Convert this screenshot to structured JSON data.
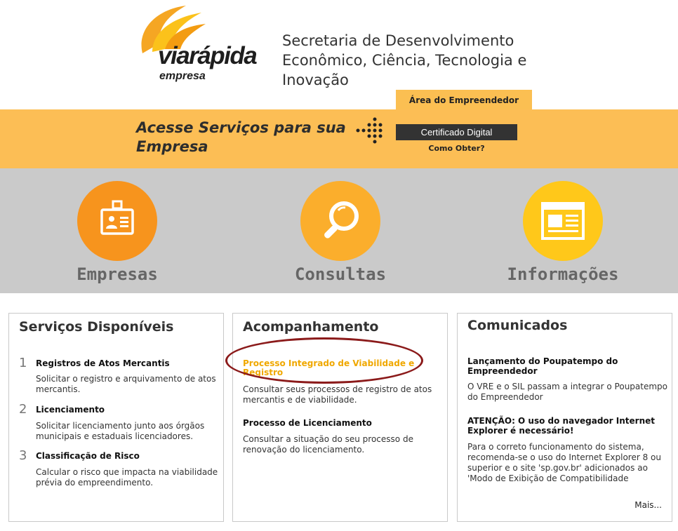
{
  "header": {
    "logo_text": "viarápida",
    "logo_sub": "empresa",
    "secretaria": "Secretaria de Desenvolvimento Econômico, Ciência, Tecnologia e Inovação",
    "area_tab": "Área do Empreendedor"
  },
  "band": {
    "title": "Acesse Serviços para sua Empresa",
    "certificado_button": "Certificado Digital",
    "como_obter": "Como Obter?"
  },
  "services": [
    {
      "label": "Empresas",
      "icon": "badge-icon",
      "color": "#f7941d"
    },
    {
      "label": "Consultas",
      "icon": "magnifier-icon",
      "color": "#fbae2c"
    },
    {
      "label": "Informações",
      "icon": "newspaper-icon",
      "color": "#ffc81a"
    }
  ],
  "servicos": {
    "title": "Serviços Disponíveis",
    "items": [
      {
        "num": "1",
        "title": "Registros de Atos Mercantis",
        "desc": "Solicitar o registro e arquivamento de atos mercantis."
      },
      {
        "num": "2",
        "title": "Licenciamento",
        "desc": "Solicitar licenciamento junto aos órgãos municipais e estaduais licenciadores."
      },
      {
        "num": "3",
        "title": "Classificação de Risco",
        "desc": "Calcular o risco que impacta na viabilidade prévia do empreendimento."
      }
    ]
  },
  "acompanhamento": {
    "title": "Acompanhamento",
    "items": [
      {
        "title": "Processo Integrado de Viabilidade e Registro",
        "desc": "Consultar seus processos de registro de atos mercantis e de viabilidade."
      },
      {
        "title": "Processo de Licenciamento",
        "desc": "Consultar a situação do seu processo de renovação do licenciamento."
      }
    ]
  },
  "comunicados": {
    "title": "Comunicados",
    "items": [
      {
        "title": "Lançamento do Poupatempo do Empreendedor",
        "desc": "O VRE e o SIL passam a integrar o Poupatempo do Empreendedor"
      },
      {
        "title": "ATENÇÃO: O uso do navegador Internet Explorer é necessário!",
        "desc": "Para o correto funcionamento do sistema, recomenda-se o uso do Internet Explorer 8 ou superior e o site 'sp.gov.br' adicionados ao 'Modo de Exibição de Compatibilidade"
      }
    ],
    "mais": "Mais..."
  },
  "colors": {
    "band": "#fcbe55",
    "grey": "#cacaca",
    "link_orange": "#f0a800",
    "highlight": "#8b1a1a"
  }
}
